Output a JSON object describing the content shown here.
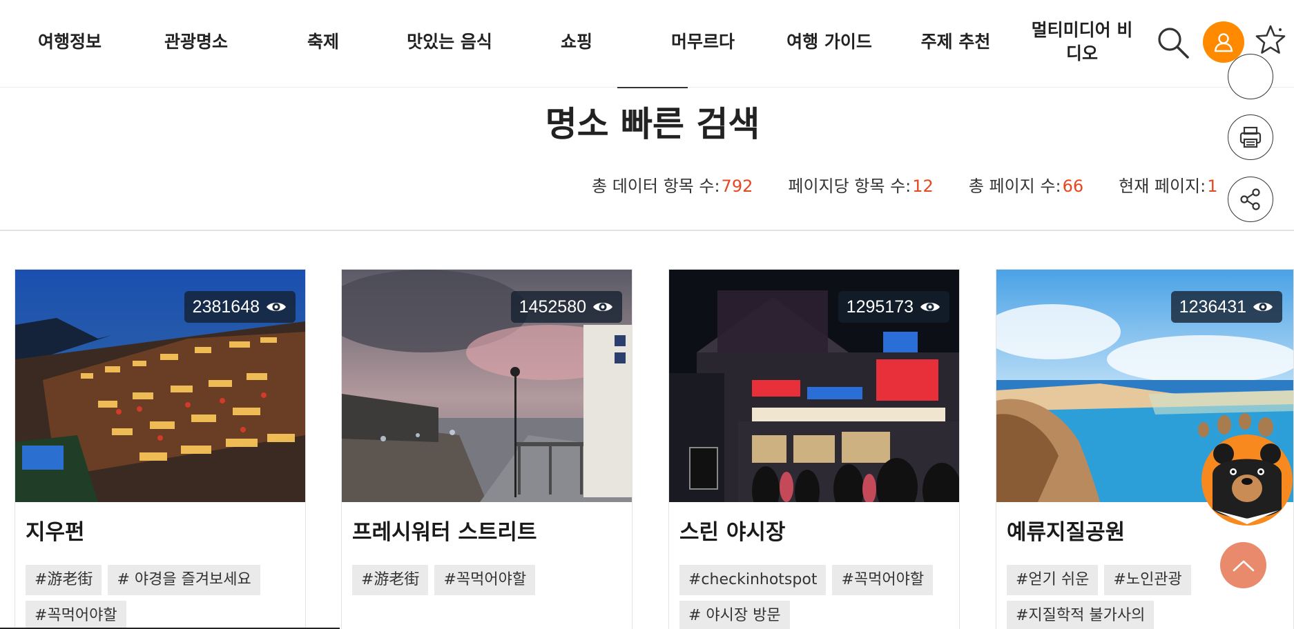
{
  "nav": {
    "items": [
      "여행정보",
      "관광명소",
      "축제",
      "맛있는 음식",
      "쇼핑",
      "머무르다",
      "여행 가이드",
      "주제 추천",
      "멀티미디어 비디오"
    ]
  },
  "header_icons": {
    "search": "search-icon",
    "user": "user-icon",
    "favorite": "star-icon"
  },
  "page": {
    "title": "명소 빠른 검색"
  },
  "stats": [
    {
      "label": "총 데이터 항목 수:",
      "value": "792"
    },
    {
      "label": "페이지당 항목 수:",
      "value": "12"
    },
    {
      "label": "총 페이지 수:",
      "value": "66"
    },
    {
      "label": "현재 페이지:",
      "value": "1"
    }
  ],
  "side_tools": [
    "print-icon",
    "share-icon"
  ],
  "cards": [
    {
      "title": "지우펀",
      "views": "2381648",
      "tags": [
        "#游老街",
        "# 야경을 즐겨보세요",
        "#꼭먹어야할"
      ]
    },
    {
      "title": "프레시워터 스트리트",
      "views": "1452580",
      "tags": [
        "#游老街",
        "#꼭먹어야할"
      ]
    },
    {
      "title": "스린 야시장",
      "views": "1295173",
      "tags": [
        "#checkinhotspot",
        "#꼭먹어야할",
        "# 야시장 방문"
      ]
    },
    {
      "title": "예류지질공원",
      "views": "1236431",
      "tags": [
        "#얻기 쉬운",
        "#노인관광",
        "#지질학적 불가사의"
      ]
    }
  ],
  "colors": {
    "accent": "#e5481f",
    "user_button": "#ff8a00",
    "to_top": "#ea8a6c"
  }
}
